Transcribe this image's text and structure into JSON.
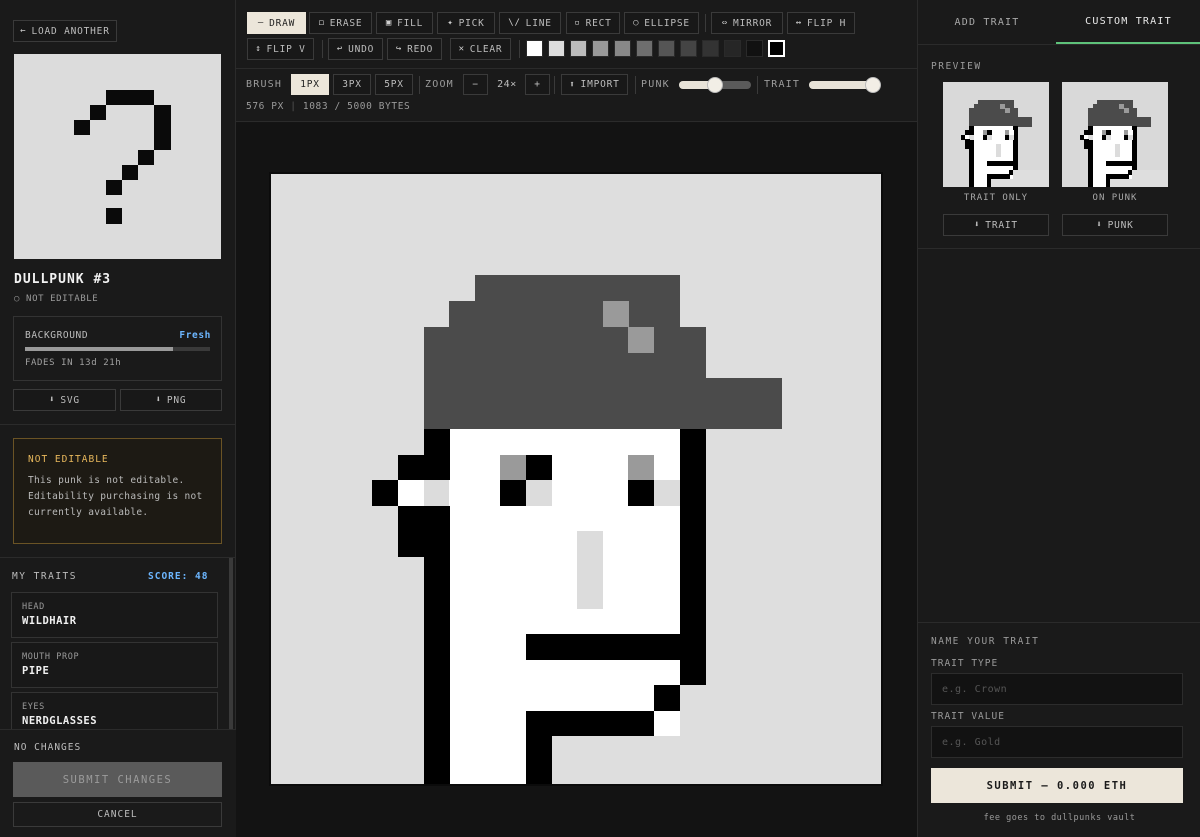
{
  "left": {
    "load_another": "LOAD ANOTHER",
    "punk_name": "DULLPUNK #3",
    "editable_status": "NOT EDITABLE",
    "background": {
      "label": "BACKGROUND",
      "status": "Fresh",
      "fades_in": "FADES IN 13d 21h",
      "freshness": 0.8
    },
    "download_svg": "SVG",
    "download_png": "PNG",
    "notice": {
      "title": "NOT EDITABLE",
      "text": "This punk is not editable. Editability purchasing is not currently available."
    },
    "traits": {
      "title": "MY TRAITS",
      "score": "SCORE: 48",
      "items": [
        {
          "type": "HEAD",
          "value": "WILDHAIR"
        },
        {
          "type": "MOUTH PROP",
          "value": "PIPE"
        },
        {
          "type": "EYES",
          "value": "NERDGLASSES"
        }
      ]
    },
    "changes_status": "NO CHANGES",
    "submit_label": "SUBMIT CHANGES",
    "cancel_label": "CANCEL"
  },
  "toolbar": {
    "tools": [
      {
        "name": "draw",
        "label": "DRAW",
        "icon": "—",
        "active": true
      },
      {
        "name": "erase",
        "label": "ERASE",
        "icon": "◻",
        "active": false
      },
      {
        "name": "fill",
        "label": "FILL",
        "icon": "▣",
        "active": false
      },
      {
        "name": "pick",
        "label": "PICK",
        "icon": "✦",
        "active": false
      },
      {
        "name": "line",
        "label": "LINE",
        "icon": "\\/",
        "active": false
      },
      {
        "name": "rect",
        "label": "RECT",
        "icon": "▫",
        "active": false
      },
      {
        "name": "ellipse",
        "label": "ELLIPSE",
        "icon": "○",
        "active": false
      },
      {
        "name": "mirror",
        "label": "MIRROR",
        "icon": "⇔",
        "active": false
      },
      {
        "name": "flip-h",
        "label": "FLIP H",
        "icon": "↔",
        "active": false
      },
      {
        "name": "flip-v",
        "label": "FLIP V",
        "icon": "↕",
        "active": false
      },
      {
        "name": "undo",
        "label": "UNDO",
        "icon": "↩",
        "active": false
      },
      {
        "name": "redo",
        "label": "REDO",
        "icon": "↪",
        "active": false
      },
      {
        "name": "clear",
        "label": "CLEAR",
        "icon": "✕",
        "active": false
      }
    ],
    "palette": [
      "#ffffff",
      "#dddddd",
      "#bbbbbb",
      "#999999",
      "#888888",
      "#6e6e6e",
      "#555555",
      "#444444",
      "#333333",
      "#262626",
      "#111111",
      "#000000"
    ],
    "selected_color": "#000000",
    "brush_label": "BRUSH",
    "brush_sizes": [
      "1PX",
      "3PX",
      "5PX"
    ],
    "brush_selected": "1PX",
    "zoom_label": "ZOOM",
    "zoom_minus": "−",
    "zoom_value": "24×",
    "zoom_plus": "+",
    "import_label": "IMPORT",
    "punk_opacity_label": "PUNK",
    "punk_opacity": 0.5,
    "trait_opacity_label": "TRAIT",
    "trait_opacity": 1.0,
    "stats": "576 PX",
    "bytes": "1083 / 5000 BYTES"
  },
  "right": {
    "tab_add": "ADD TRAIT",
    "tab_custom": "CUSTOM TRAIT",
    "preview_label": "PREVIEW",
    "caption_trait_only": "TRAIT ONLY",
    "caption_on_punk": "ON PUNK",
    "download_trait": "TRAIT",
    "download_punk": "PUNK",
    "name_section_label": "NAME YOUR TRAIT",
    "trait_type_label": "TRAIT TYPE",
    "trait_type_placeholder": "e.g. Crown",
    "trait_value_label": "TRAIT VALUE",
    "trait_value_placeholder": "e.g. Gold",
    "submit_label": "SUBMIT — 0.000 ETH",
    "fee_note": "fee goes to dullpunks vault"
  },
  "colors": {
    "accent_blue": "#6cb6ff",
    "accent_green": "#5ec27a",
    "warning": "#e8b85c",
    "cream": "#ece6da"
  }
}
